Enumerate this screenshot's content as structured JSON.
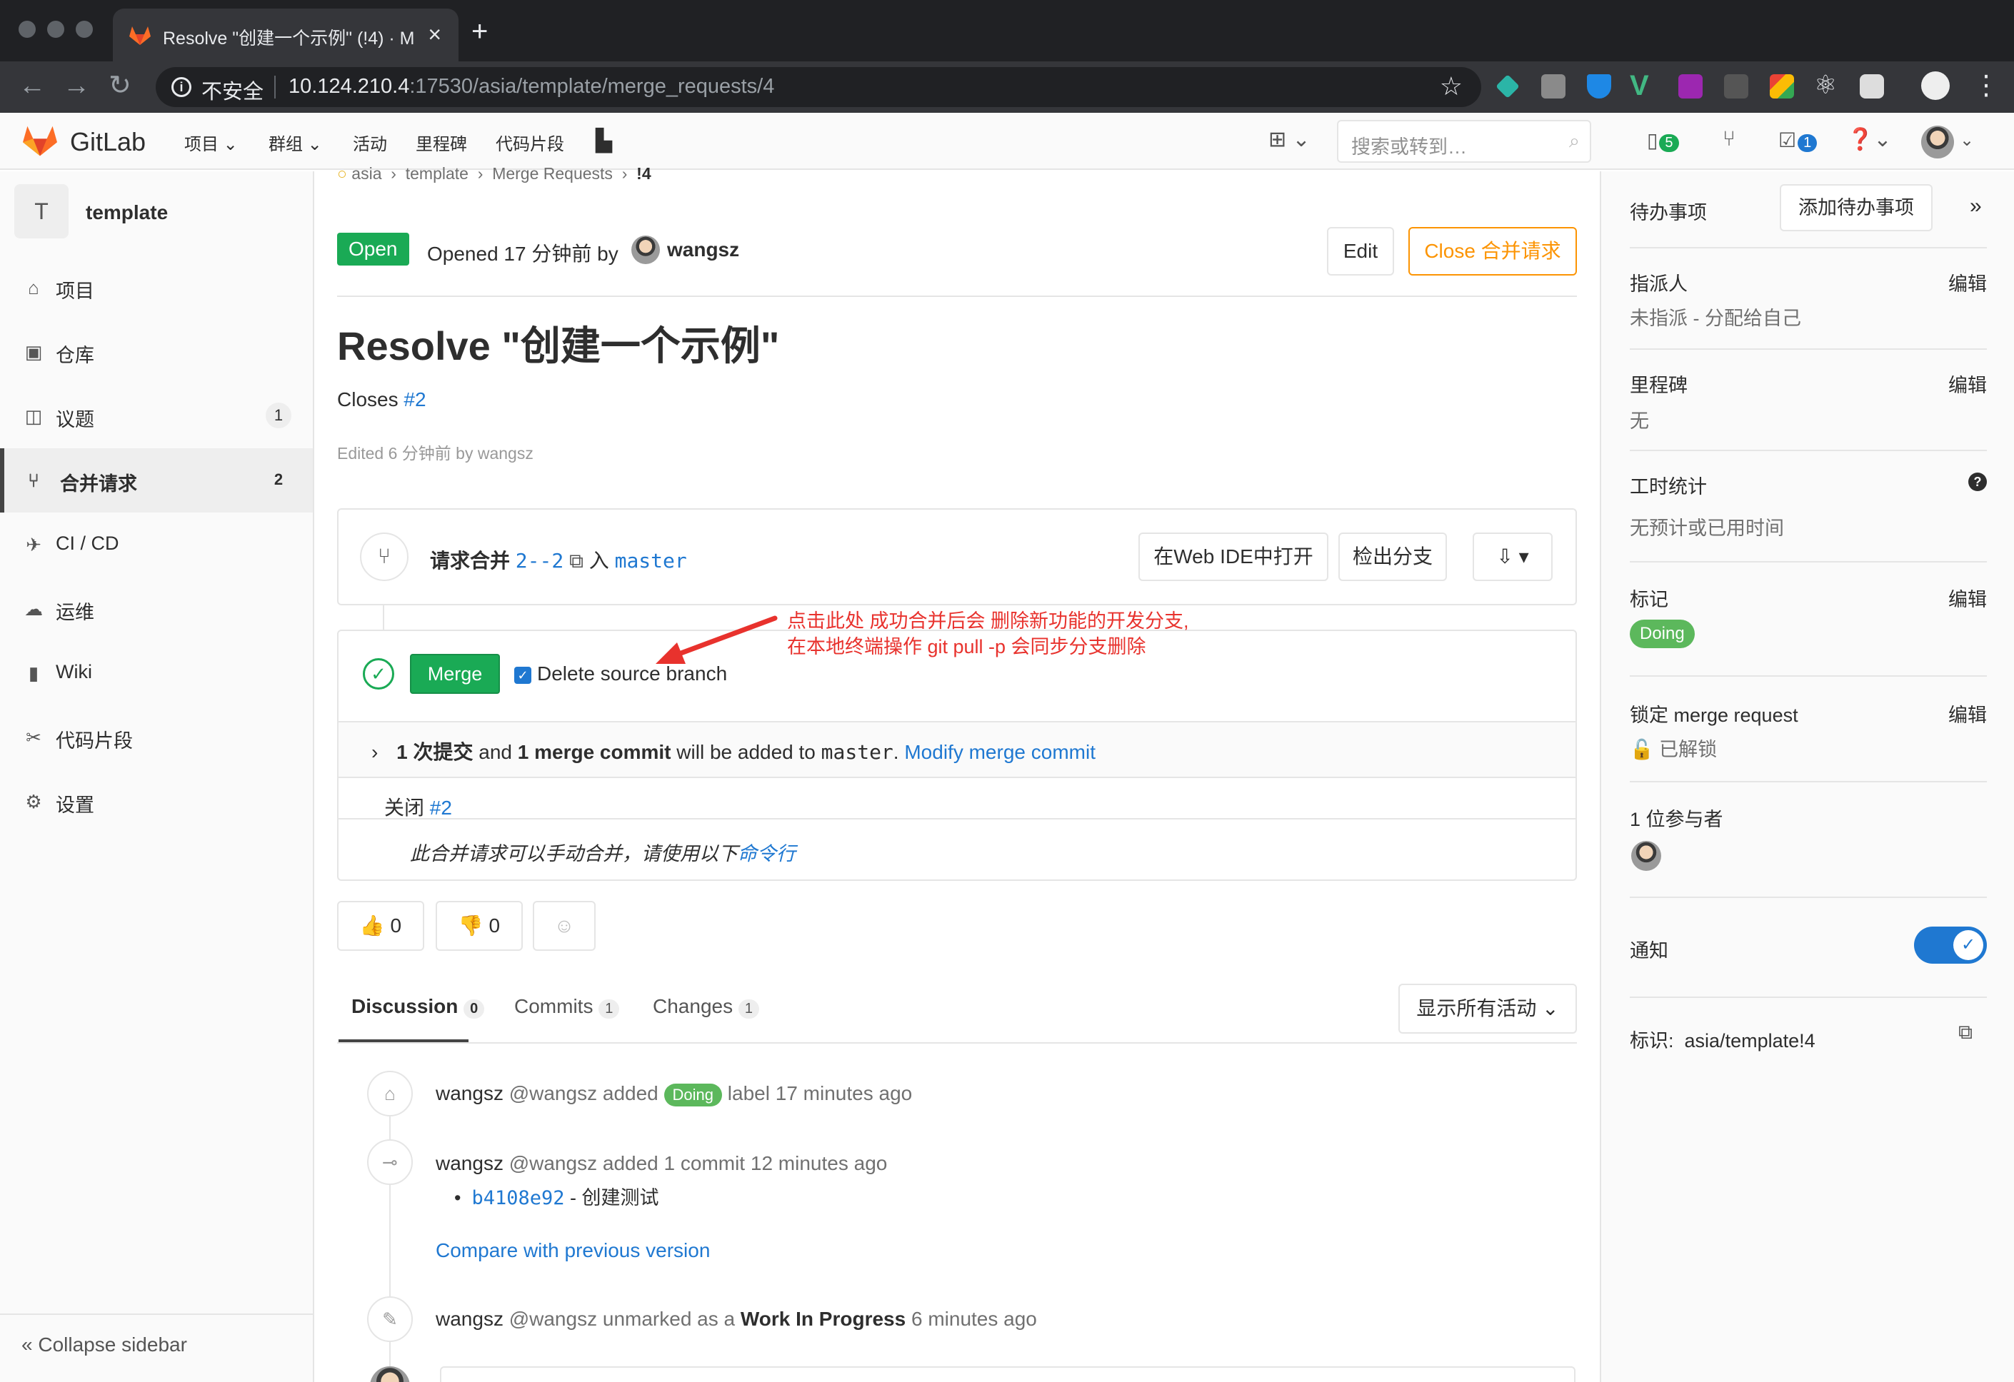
{
  "browser": {
    "tab_title": "Resolve \"创建一个示例\" (!4) · M",
    "not_secure": "不安全",
    "url_host": "10.124.210.4",
    "url_rest": ":17530/asia/template/merge_requests/4"
  },
  "header": {
    "brand": "GitLab",
    "nav": [
      "项目",
      "群组",
      "活动",
      "里程碑",
      "代码片段"
    ],
    "search_placeholder": "搜索或转到…",
    "issues_count": "5",
    "todos_count": "1"
  },
  "sidebar": {
    "project_initial": "T",
    "project_name": "template",
    "items": [
      {
        "label": "项目",
        "icon": "home-icon",
        "count": ""
      },
      {
        "label": "仓库",
        "icon": "repository-icon",
        "count": ""
      },
      {
        "label": "议题",
        "icon": "issues-icon",
        "count": "1"
      },
      {
        "label": "合并请求",
        "icon": "merge-request-icon",
        "count": "2"
      },
      {
        "label": "CI / CD",
        "icon": "rocket-icon",
        "count": ""
      },
      {
        "label": "运维",
        "icon": "cloud-gear-icon",
        "count": ""
      },
      {
        "label": "Wiki",
        "icon": "book-icon",
        "count": ""
      },
      {
        "label": "代码片段",
        "icon": "scissors-icon",
        "count": ""
      },
      {
        "label": "设置",
        "icon": "gear-icon",
        "count": ""
      }
    ],
    "collapse": "Collapse sidebar"
  },
  "breadcrumb": [
    "asia",
    "template",
    "Merge Requests",
    "!4"
  ],
  "mr": {
    "status": "Open",
    "opened": "Opened 17 分钟前 by",
    "author": "wangsz",
    "edit": "Edit",
    "close": "Close 合并请求",
    "title": "Resolve \"创建一个示例\"",
    "desc_prefix": "Closes",
    "desc_link": "#2",
    "edited": "Edited 6 分钟前 by wangsz"
  },
  "widget": {
    "request_label": "请求合并",
    "source_branch": "2--2",
    "into": "入",
    "target_branch": "master",
    "web_ide": "在Web IDE中打开",
    "checkout": "检出分支",
    "merge_btn": "Merge",
    "delete_source": "Delete source branch",
    "commits_bold1": "1 次提交",
    "commits_and": "and",
    "commits_bold2": "1 merge commit",
    "commits_will": "will be added to",
    "commits_target": "master",
    "commits_period": ".",
    "modify": "Modify merge commit",
    "close_prefix": "关闭",
    "close_link": "#2",
    "manual_text": "此合并请求可以手动合并，请使用以下",
    "manual_link": "命令行"
  },
  "annotation": {
    "line1": "点击此处 成功合并后会 删除新功能的开发分支,",
    "line2": "在本地终端操作 git pull -p 会同步分支删除",
    "color": "#e8322d"
  },
  "awards": {
    "thumbsup": "0",
    "thumbsdown": "0"
  },
  "tabs": {
    "discussion": "Discussion",
    "discussion_count": "0",
    "commits": "Commits",
    "commits_count": "1",
    "changes": "Changes",
    "changes_count": "1",
    "filter": "显示所有活动"
  },
  "activity": [
    {
      "author": "wangsz",
      "handle": "@wangsz",
      "action": "added",
      "label": "Doing",
      "after": "label",
      "time": "17 minutes ago"
    },
    {
      "author": "wangsz",
      "handle": "@wangsz",
      "action": "added 1 commit",
      "time": "12 minutes ago",
      "commit_sha": "b4108e92",
      "commit_msg": "- 创建测试",
      "compare": "Compare with previous version"
    },
    {
      "author": "wangsz",
      "handle": "@wangsz",
      "action": "unmarked as a",
      "bold": "Work In Progress",
      "time": "6 minutes ago"
    }
  ],
  "right": {
    "todo": "待办事项",
    "add_todo": "添加待办事项",
    "assignee": "指派人",
    "edit": "编辑",
    "assignee_value": "未指派 - 分配给自己",
    "milestone": "里程碑",
    "milestone_value": "无",
    "time": "工时统计",
    "time_value": "无预计或已用时间",
    "labels": "标记",
    "label_value": "Doing",
    "lock": "锁定 merge request",
    "lock_value": "已解锁",
    "participants": "1 位参与者",
    "notify": "通知",
    "ref_label": "标识:",
    "ref_value": "asia/template!4"
  },
  "colors": {
    "green": "#1aaa55",
    "blue": "#1f78d1",
    "orange": "#fc9403",
    "doing": "#5cb85c"
  }
}
